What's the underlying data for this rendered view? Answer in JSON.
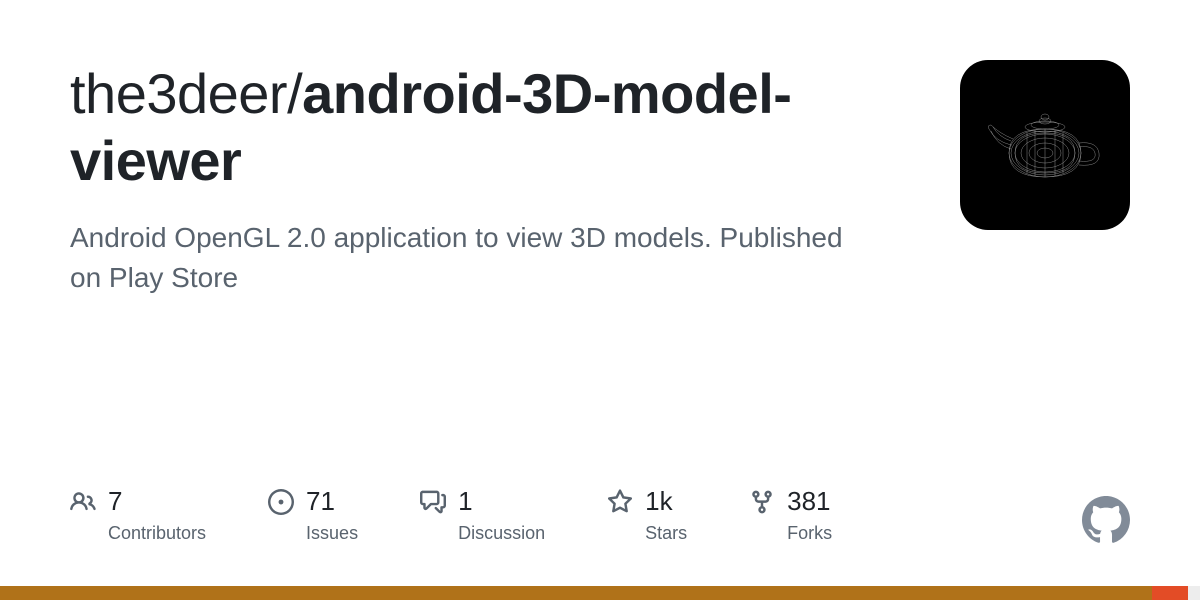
{
  "repo": {
    "owner": "the3deer",
    "name": "android-3D-model-viewer",
    "description": "Android OpenGL 2.0 application to view 3D models. Published on Play Store"
  },
  "stats": [
    {
      "icon": "people",
      "count": "7",
      "label": "Contributors"
    },
    {
      "icon": "issue",
      "count": "71",
      "label": "Issues"
    },
    {
      "icon": "discussion",
      "count": "1",
      "label": "Discussion"
    },
    {
      "icon": "star",
      "count": "1k",
      "label": "Stars"
    },
    {
      "icon": "fork",
      "count": "381",
      "label": "Forks"
    }
  ],
  "languages": [
    {
      "color": "#b07219",
      "percent": 96
    },
    {
      "color": "#e34c26",
      "percent": 3
    },
    {
      "color": "#ededed",
      "percent": 1
    }
  ]
}
